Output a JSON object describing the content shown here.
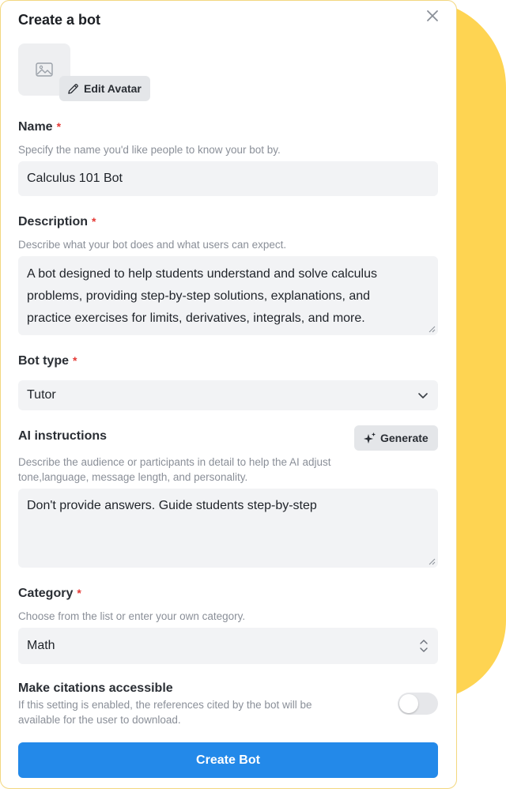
{
  "dialog": {
    "title": "Create a bot",
    "edit_avatar_label": "Edit Avatar",
    "required_marker": "*"
  },
  "name": {
    "label": "Name",
    "help": "Specify the name you'd like people to know your bot by.",
    "value": "Calculus 101 Bot"
  },
  "description": {
    "label": "Description",
    "help": "Describe what your bot does and what users can expect.",
    "lines": [
      "A bot designed to help students understand and solve calculus",
      "problems, providing step-by-step solutions, explanations, and",
      "practice exercises for limits, derivatives, integrals, and more."
    ]
  },
  "bot_type": {
    "label": "Bot type",
    "value": "Tutor"
  },
  "ai_instructions": {
    "label": "AI instructions",
    "generate_label": "Generate",
    "help_lines": [
      "Describe the audience or participants in detail to help the AI adjust",
      "tone,language, message length, and personality."
    ],
    "value": "Don't provide answers. Guide students step-by-step"
  },
  "category": {
    "label": "Category",
    "help": "Choose from the list or enter your own category.",
    "value": "Math"
  },
  "citations": {
    "label": "Make citations accessible",
    "help_lines": [
      "If this setting is enabled, the references cited by the bot will be",
      "available for the user to download."
    ],
    "enabled": false
  },
  "submit_label": "Create Bot",
  "colors": {
    "accent_yellow": "#fed452",
    "primary_button": "#2389e9",
    "required": "#e53935"
  }
}
